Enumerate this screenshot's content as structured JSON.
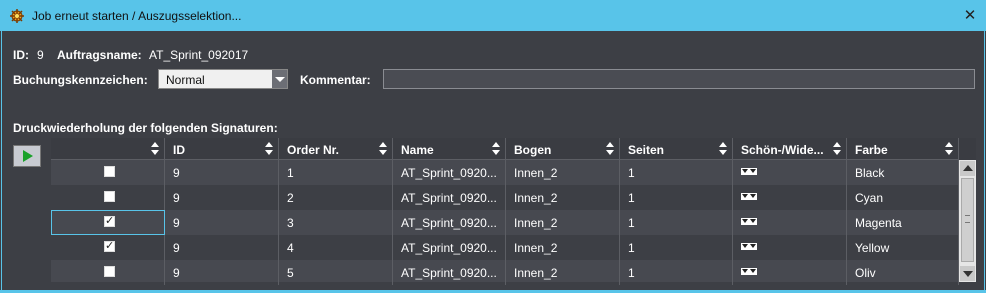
{
  "window": {
    "title": "Job erneut starten / Auszugsselektion...",
    "close_glyph": "✕"
  },
  "form": {
    "id_label": "ID:",
    "id_value": "9",
    "order_label": "Auftragsname:",
    "order_value": "AT_Sprint_092017",
    "booking_label": "Buchungskennzeichen:",
    "booking_value": "Normal",
    "comment_label": "Kommentar:",
    "comment_value": "",
    "section_label": "Druckwiederholung der folgenden Signaturen:"
  },
  "table": {
    "columns": [
      "",
      "ID",
      "Order Nr.",
      "Name",
      "Bogen",
      "Seiten",
      "Schön-/Wide...",
      "Farbe"
    ],
    "rows": [
      {
        "checked": false,
        "id": "9",
        "order": "1",
        "name": "AT_Sprint_0920...",
        "bogen": "Innen_2",
        "seiten": "1",
        "farbe": "Black"
      },
      {
        "checked": false,
        "id": "9",
        "order": "2",
        "name": "AT_Sprint_0920...",
        "bogen": "Innen_2",
        "seiten": "1",
        "farbe": "Cyan"
      },
      {
        "checked": true,
        "id": "9",
        "order": "3",
        "name": "AT_Sprint_0920...",
        "bogen": "Innen_2",
        "seiten": "1",
        "farbe": "Magenta"
      },
      {
        "checked": true,
        "id": "9",
        "order": "4",
        "name": "AT_Sprint_0920...",
        "bogen": "Innen_2",
        "seiten": "1",
        "farbe": "Yellow"
      },
      {
        "checked": false,
        "id": "9",
        "order": "5",
        "name": "AT_Sprint_0920...",
        "bogen": "Innen_2",
        "seiten": "1",
        "farbe": "Oliv"
      }
    ]
  },
  "icons": {
    "app": "app-icon",
    "play": "play-icon",
    "close": "close-icon",
    "sort": "sort-icon",
    "schoen_wider": "schoen-wider-icon"
  },
  "colors": {
    "titlebar": "#58c4e9",
    "background": "#3d3f45",
    "play": "#1aa12a"
  }
}
